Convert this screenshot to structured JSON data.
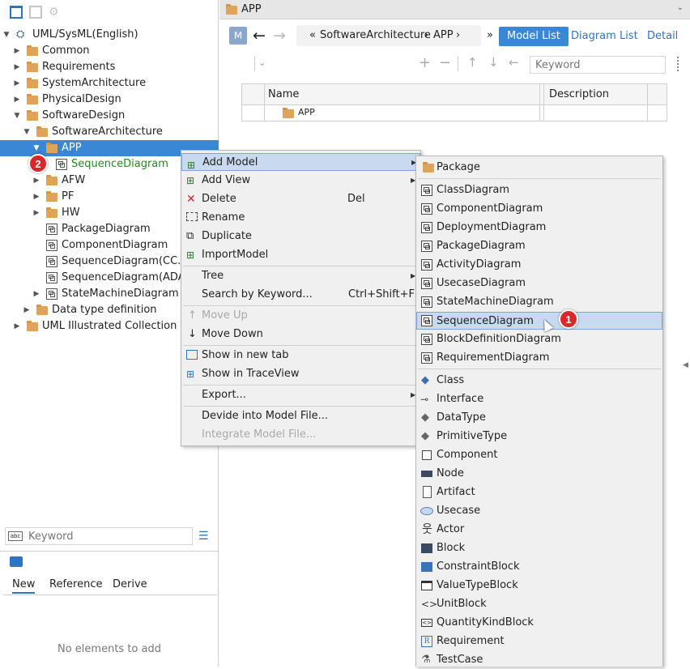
{
  "tree": {
    "root": "UML/SysML(English)",
    "rows": [
      {
        "label": "Common"
      },
      {
        "label": "Requirements"
      },
      {
        "label": "SystemArchitecture"
      },
      {
        "label": "PhysicalDesign"
      },
      {
        "label": "SoftwareDesign"
      },
      {
        "label": "SoftwareArchitecture"
      },
      {
        "label": "APP"
      },
      {
        "label": "SequenceDiagram"
      },
      {
        "label": "AFW"
      },
      {
        "label": "PF"
      },
      {
        "label": "HW"
      },
      {
        "label": "PackageDiagram"
      },
      {
        "label": "ComponentDiagram"
      },
      {
        "label": "SequenceDiagram(CC. Up"
      },
      {
        "label": "SequenceDiagram(ADAPT"
      },
      {
        "label": "StateMachineDiagram"
      },
      {
        "label": "Data type definition"
      },
      {
        "label": "UML Illustrated Collection"
      }
    ],
    "badge": "2"
  },
  "left_search": {
    "placeholder": "Keyword"
  },
  "bottom_panel": {
    "tabs": [
      "New",
      "Reference",
      "Derive"
    ],
    "empty_text": "No elements to add"
  },
  "right": {
    "tab_title": "APP",
    "m_badge": "M",
    "breadcrumb": {
      "prefix": "«",
      "path1": "SoftwareArchitecture",
      "sep": "›",
      "path2": "APP",
      "end": "›"
    },
    "overflow": "»",
    "views": {
      "model_list": "Model List",
      "diagram_list": "Diagram List",
      "detail": "Detail"
    },
    "keyword_placeholder": "Keyword",
    "grid": {
      "col_name": "Name",
      "col_desc": "Description",
      "row_name": "APP"
    }
  },
  "context_menu": {
    "items": [
      {
        "label": "Add Model",
        "shortcut": ""
      },
      {
        "label": "Add View",
        "shortcut": ""
      },
      {
        "label": "Delete",
        "shortcut": "Del"
      },
      {
        "label": "Rename",
        "shortcut": ""
      },
      {
        "label": "Duplicate",
        "shortcut": ""
      },
      {
        "label": "ImportModel",
        "shortcut": ""
      },
      {
        "label": "Tree",
        "shortcut": ""
      },
      {
        "label": "Search by Keyword...",
        "shortcut": "Ctrl+Shift+F"
      },
      {
        "label": "Move Up",
        "shortcut": ""
      },
      {
        "label": "Move Down",
        "shortcut": ""
      },
      {
        "label": "Show in new tab",
        "shortcut": ""
      },
      {
        "label": "Show in TraceView",
        "shortcut": ""
      },
      {
        "label": "Export...",
        "shortcut": ""
      },
      {
        "label": "Devide into Model File...",
        "shortcut": ""
      },
      {
        "label": "Integrate Model File...",
        "shortcut": ""
      }
    ]
  },
  "submenu": {
    "items": [
      "Package",
      "ClassDiagram",
      "ComponentDiagram",
      "DeploymentDiagram",
      "PackageDiagram",
      "ActivityDiagram",
      "UsecaseDiagram",
      "StateMachineDiagram",
      "SequenceDiagram",
      "BlockDefinitionDiagram",
      "RequirementDiagram",
      "Class",
      "Interface",
      "DataType",
      "PrimitiveType",
      "Component",
      "Node",
      "Artifact",
      "Usecase",
      "Actor",
      "Block",
      "ConstraintBlock",
      "ValueTypeBlock",
      "UnitBlock",
      "QuantityKindBlock",
      "Requirement",
      "TestCase"
    ],
    "badge": "1"
  },
  "colors": {
    "selection": "#3a87d6",
    "menu_highlight": "#c8d9f0",
    "badge": "#d9282a",
    "folder": "#e0a35a",
    "link": "#2d74c4"
  }
}
